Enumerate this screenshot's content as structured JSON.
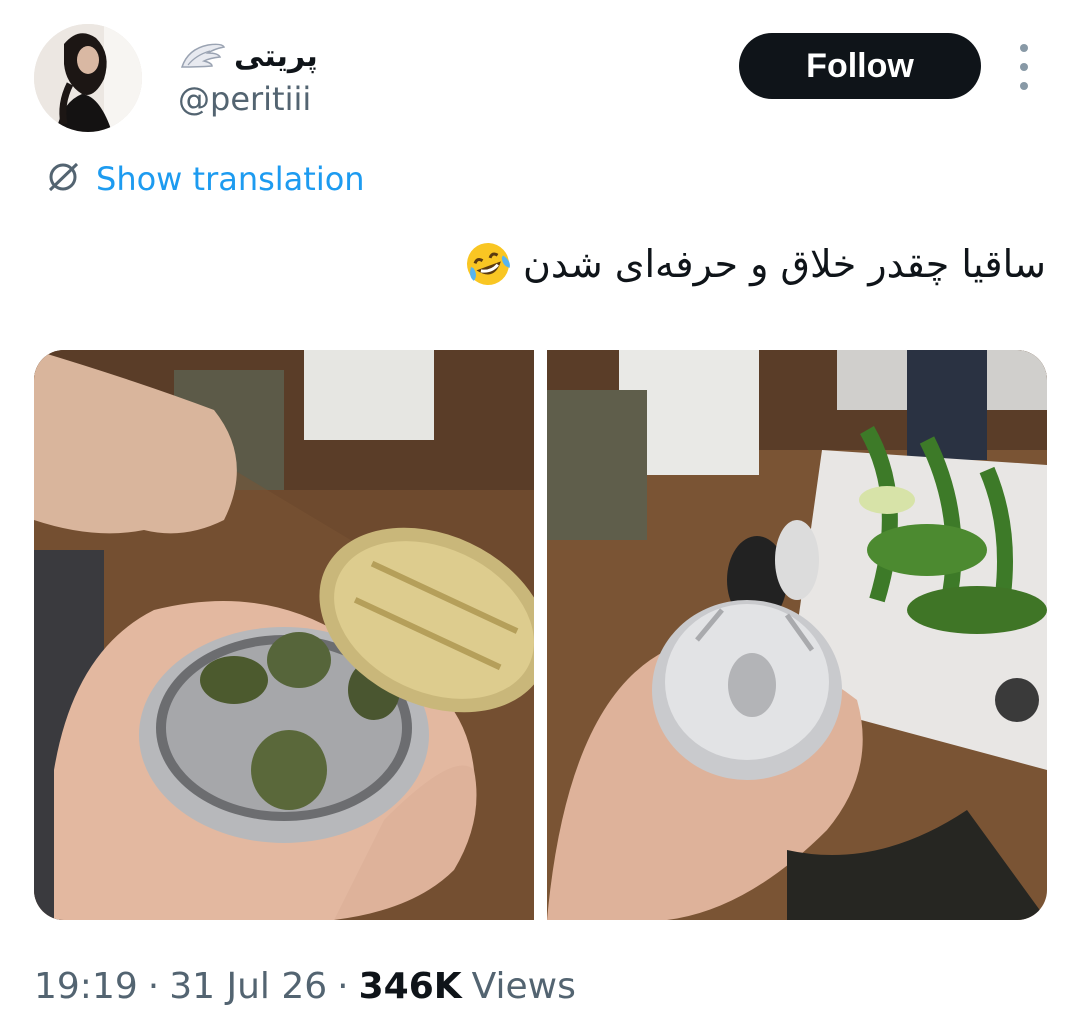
{
  "author": {
    "display_name": "پریتی",
    "handle": "@peritiii",
    "badge_icon": "wing-icon"
  },
  "actions": {
    "follow_label": "Follow",
    "more_icon": "more-vertical-icon"
  },
  "translation": {
    "label": "Show translation",
    "icon": "translate-icon"
  },
  "tweet": {
    "text": "ساقیا چقدر خلاق و حرفه‌ای شدن",
    "emoji": "rolling-on-floor-laughing",
    "media": [
      {
        "description_icon": "photo-open-tin-can"
      },
      {
        "description_icon": "photo-closed-tin-can"
      }
    ]
  },
  "meta": {
    "time": "19:19",
    "separator": "·",
    "date": "31 Jul 26",
    "views_count": "346K",
    "views_label": "Views"
  },
  "colors": {
    "accent": "#1d9bf0",
    "text": "#0f1419",
    "muted": "#536471",
    "follow_bg": "#0f1419"
  }
}
